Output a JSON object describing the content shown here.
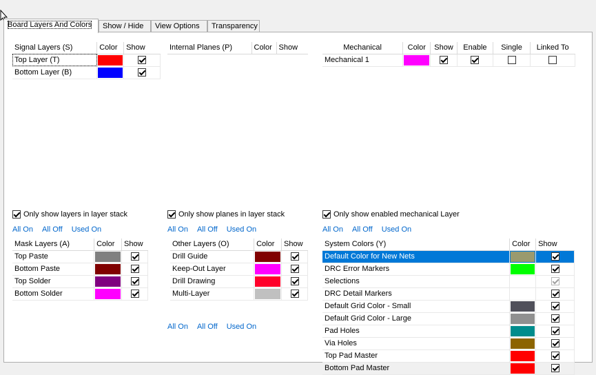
{
  "tabs": [
    "Board Layers And Colors",
    "Show / Hide",
    "View Options",
    "Transparency"
  ],
  "signal_layers": {
    "headers": [
      "Signal Layers (S)",
      "Color",
      "Show"
    ],
    "rows": [
      {
        "name": "Top Layer (T)",
        "color": "#ff0000",
        "show": true
      },
      {
        "name": "Bottom Layer (B)",
        "color": "#0000ff",
        "show": true
      }
    ]
  },
  "internal_planes": {
    "headers": [
      "Internal Planes (P)",
      "Color",
      "Show"
    ]
  },
  "mechanical": {
    "headers": [
      "Mechanical",
      "Color",
      "Show",
      "Enable",
      "Single",
      "Linked To"
    ],
    "rows": [
      {
        "name": "Mechanical 1",
        "color": "#ff00ff",
        "show": true,
        "enable": true,
        "single": false,
        "linked": false
      }
    ]
  },
  "options": {
    "signal": "Only show layers in layer stack",
    "planes": "Only show planes in layer stack",
    "mechanical": "Only show enabled mechanical Layer"
  },
  "links": {
    "all_on": "All On",
    "all_off": "All Off",
    "used_on": "Used On"
  },
  "mask_layers": {
    "headers": [
      "Mask Layers (A)",
      "Color",
      "Show"
    ],
    "rows": [
      {
        "name": "Top Paste",
        "color": "#808080",
        "show": true
      },
      {
        "name": "Bottom Paste",
        "color": "#800000",
        "show": true
      },
      {
        "name": "Top Solder",
        "color": "#800080",
        "show": true
      },
      {
        "name": "Bottom Solder",
        "color": "#ff00ff",
        "show": true
      }
    ]
  },
  "other_layers": {
    "headers": [
      "Other Layers (O)",
      "Color",
      "Show"
    ],
    "rows": [
      {
        "name": "Drill Guide",
        "color": "#800000",
        "show": true
      },
      {
        "name": "Keep-Out Layer",
        "color": "#ff00ff",
        "show": true
      },
      {
        "name": "Drill Drawing",
        "color": "#ff002a",
        "show": true
      },
      {
        "name": "Multi-Layer",
        "color": "#c0c0c0",
        "show": true
      }
    ]
  },
  "system_colors": {
    "headers": [
      "System Colors (Y)",
      "Color",
      "Show"
    ],
    "rows": [
      {
        "name": "Default Color for New Nets",
        "color": "#9a9a6e",
        "show": true,
        "selected": true
      },
      {
        "name": "DRC Error Markers",
        "color": "#00ff00",
        "show": true
      },
      {
        "name": "Selections",
        "color": "#ffffff",
        "show": true,
        "disabled": true
      },
      {
        "name": "DRC Detail Markers",
        "color": "#ffffff",
        "show": true
      },
      {
        "name": "Default Grid Color - Small",
        "color": "#50505a",
        "show": true
      },
      {
        "name": "Default Grid Color - Large",
        "color": "#909090",
        "show": true
      },
      {
        "name": "Pad Holes",
        "color": "#008c8c",
        "show": true
      },
      {
        "name": "Via Holes",
        "color": "#8c6400",
        "show": true
      },
      {
        "name": "Top Pad Master",
        "color": "#ff0000",
        "show": true
      },
      {
        "name": "Bottom Pad Master",
        "color": "#ff0000",
        "show": true
      }
    ]
  }
}
